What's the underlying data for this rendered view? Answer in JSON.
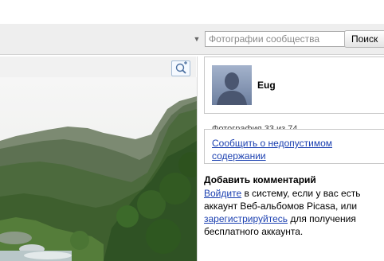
{
  "search": {
    "placeholder": "Фотографии сообщества",
    "button_label": "Поиск"
  },
  "viewer": {
    "zoom_icon": "magnifier-plus-icon"
  },
  "user": {
    "name": "Eug",
    "avatar_icon": "default-avatar-silhouette"
  },
  "photo_counter": "Фотография 33 из 74",
  "report_link": "Сообщить о недопустимом содержании",
  "comments": {
    "title": "Добавить комментарий",
    "signin_link": "Войдите",
    "text_1": " в систему, если у вас есть аккаунт Веб-альбомов Picasa, или ",
    "register_link": "зарегистрируйтесь",
    "text_2": " для получения бесплатного аккаунта."
  },
  "colors": {
    "link": "#1a3fb0",
    "toolbar_bg": "#eeeeee",
    "panel_border": "#c8c8c8"
  }
}
